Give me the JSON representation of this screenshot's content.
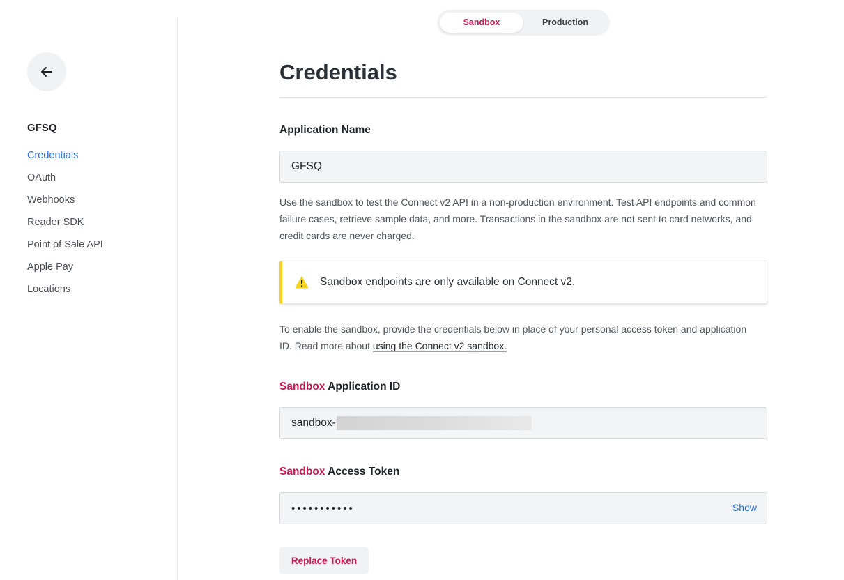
{
  "sidebar": {
    "app_name": "GFSQ",
    "items": [
      {
        "label": "Credentials",
        "active": true
      },
      {
        "label": "OAuth"
      },
      {
        "label": "Webhooks"
      },
      {
        "label": "Reader SDK"
      },
      {
        "label": "Point of Sale API"
      },
      {
        "label": "Apple Pay"
      },
      {
        "label": "Locations"
      }
    ]
  },
  "env_toggle": {
    "sandbox_label": "Sandbox",
    "production_label": "Production",
    "selected": "Sandbox"
  },
  "main": {
    "title": "Credentials",
    "app_name_label": "Application Name",
    "app_name_value": "GFSQ",
    "sandbox_desc": "Use the sandbox to test the Connect v2 API in a non-production environment. Test API endpoints and common failure cases, retrieve sample data, and more. Transactions in the sandbox are not sent to card networks, and credit cards are never charged.",
    "warning": "Sandbox endpoints are only available on Connect v2.",
    "enable_desc_prefix": "To enable the sandbox, provide the credentials below in place of your personal access token and application ID. Read more about ",
    "enable_desc_link": "using the Connect v2 sandbox.",
    "app_id_label_accent": "Sandbox",
    "app_id_label_rest": " Application ID",
    "app_id_prefix": "sandbox-",
    "token_label_accent": "Sandbox",
    "token_label_rest": " Access Token",
    "token_masked": "•••••••••••",
    "show_label": "Show",
    "replace_button": "Replace Token"
  },
  "colors": {
    "accent": "#d0154f",
    "link": "#2a6fdb",
    "warning": "#f5d21b"
  }
}
